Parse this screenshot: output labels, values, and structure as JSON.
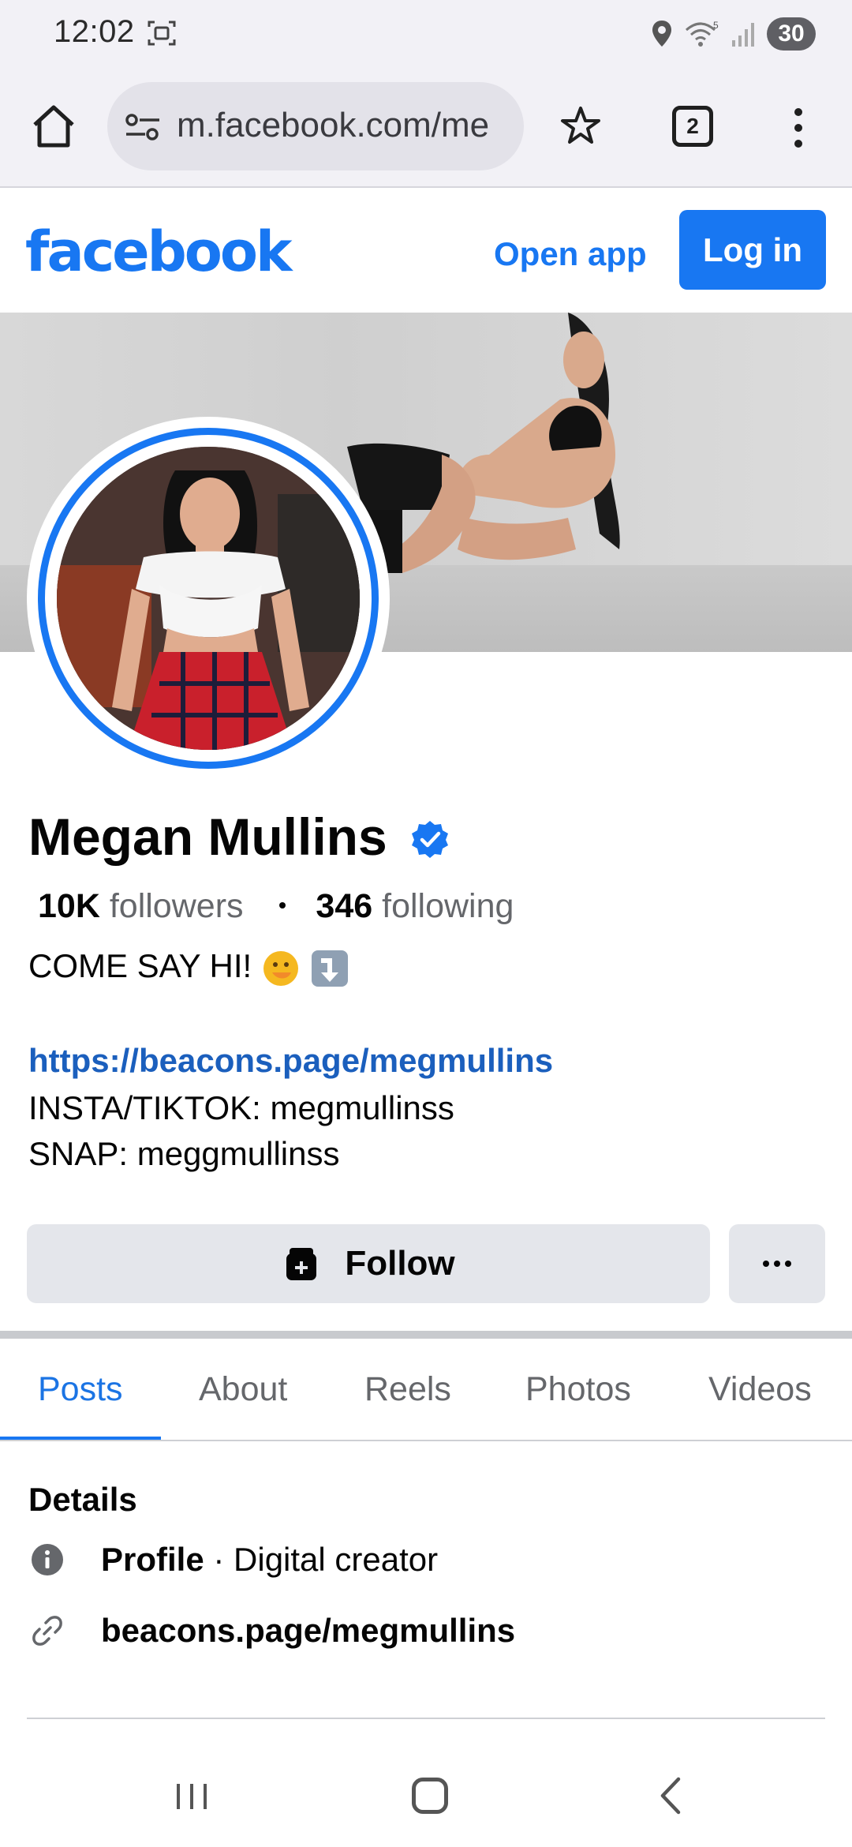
{
  "status_bar": {
    "time": "12:02",
    "battery": "30",
    "icons": [
      "screenshot-icon",
      "location-icon",
      "wifi-icon",
      "signal-icon",
      "battery-icon"
    ]
  },
  "browser": {
    "url": "m.facebook.com/me",
    "tab_count": "2",
    "icons": [
      "home-icon",
      "site-settings-icon",
      "star-icon",
      "tabs-icon",
      "more-vert-icon"
    ]
  },
  "header": {
    "logo": "facebook",
    "open_app": "Open app",
    "login": "Log in"
  },
  "profile": {
    "name": "Megan Mullins",
    "followers_count": "10K",
    "followers_label": "followers",
    "following_count": "346",
    "following_label": "following",
    "bio_text": "COME SAY HI! ",
    "link": "https://beacons.page/megmullins",
    "line_insta": "INSTA/TIKTOK: megmullinss",
    "line_snap": "SNAP: meggmullinss"
  },
  "actions": {
    "follow": "Follow"
  },
  "tabs": [
    {
      "label": "Posts",
      "active": true
    },
    {
      "label": "About",
      "active": false
    },
    {
      "label": "Reels",
      "active": false
    },
    {
      "label": "Photos",
      "active": false
    },
    {
      "label": "Videos",
      "active": false
    }
  ],
  "details": {
    "title": "Details",
    "profile_label": "Profile",
    "profile_value": " · Digital creator",
    "link": "beacons.page/megmullins"
  },
  "colors": {
    "brand": "#1877f2",
    "link": "#1b5fbd",
    "button_bg": "#e4e6eb",
    "muted_text": "#65676b"
  }
}
